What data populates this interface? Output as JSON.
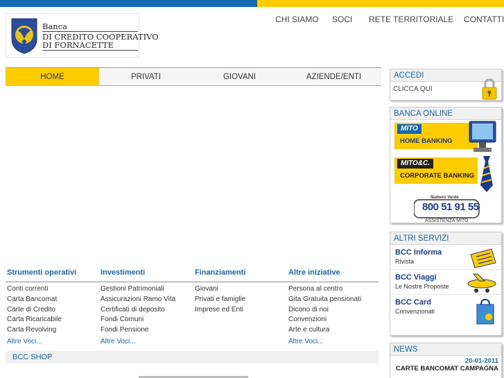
{
  "header": {
    "logo": {
      "line1": "Banca",
      "line2": "di Credito Cooperativo",
      "line3": "di Fornacette"
    },
    "top_links": [
      "CHI SIAMO",
      "SOCI",
      "RETE TERRITORIALE",
      "CONTATTI"
    ]
  },
  "nav": {
    "items": [
      "HOME",
      "PRIVATI",
      "GIOVANI",
      "AZIENDE/ENTI"
    ],
    "active": "HOME"
  },
  "sections": [
    {
      "title": "Strumenti operativi",
      "items": [
        "Conti correnti",
        "Carta Bancomat",
        "Carte di Credito",
        "Carta Ricaricabile",
        "Carta Revolving"
      ],
      "more": "Altre Voci..."
    },
    {
      "title": "Investimenti",
      "items": [
        "Gestioni Patrimoniali",
        "Assicurazioni Ramo Vita",
        "Certificati di deposito",
        "Fondi Comuni",
        "Fondi Pensione"
      ],
      "more": "Altre Voci..."
    },
    {
      "title": "Finanziamenti",
      "items": [
        "Giovani",
        "Privati e famiglie",
        "Imprese ed Enti"
      ],
      "more": ""
    },
    {
      "title": "Altre iniziative",
      "items": [
        "Persona al centro",
        "Gita Gratuita pensionati",
        "Dicono di noi",
        "Convenzioni",
        "Arte e cultura"
      ],
      "more": "Altre Voci..."
    }
  ],
  "shop": {
    "title": "BCC SHOP"
  },
  "sidebar": {
    "accedi": {
      "title": "ACCEDI",
      "link": "CLICCA QUI"
    },
    "banca_online": {
      "title": "BANCA ONLINE",
      "home_banking": {
        "logo": "MITO",
        "label": "HOME BANKING"
      },
      "corporate_banking": {
        "logo": "MITO&C.",
        "label": "CORPORATE BANKING"
      },
      "numero_verde": {
        "caption": "Numero Verde",
        "number": "800 51 91 55",
        "assistance": "ASSISTENZA MITO"
      }
    },
    "altri_servizi": {
      "title": "ALTRI SERVIZI",
      "items": [
        {
          "title": "BCC Informa",
          "subtitle": "Rivista",
          "icon": "magazine-icon"
        },
        {
          "title": "BCC Viaggi",
          "subtitle": "Le Nostre Proposte",
          "icon": "airplane-icon"
        },
        {
          "title": "BCC Card",
          "subtitle": "Convenzionati",
          "icon": "shopping-bag-icon"
        }
      ]
    },
    "news": {
      "title": "NEWS",
      "date": "20-01-2011",
      "headline": "CARTE BANCOMAT CAMPAGNA"
    }
  },
  "colors": {
    "brand_blue": "#1668b1",
    "brand_yellow": "#ffcc00"
  }
}
